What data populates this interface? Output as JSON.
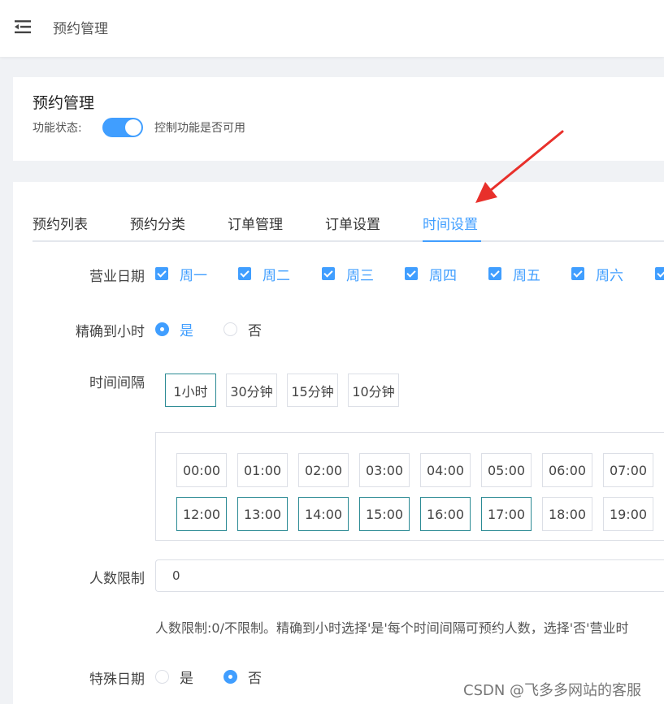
{
  "header": {
    "title": "预约管理",
    "menu_icon": "menu-fold-icon"
  },
  "module": {
    "title": "预约管理",
    "status_label": "功能状态:",
    "status_on": true,
    "status_desc": "控制功能是否可用"
  },
  "tabs": [
    {
      "label": "预约列表",
      "active": false
    },
    {
      "label": "预约分类",
      "active": false
    },
    {
      "label": "订单管理",
      "active": false
    },
    {
      "label": "订单设置",
      "active": false
    },
    {
      "label": "时间设置",
      "active": true
    }
  ],
  "form": {
    "business_days": {
      "label": "营业日期",
      "options": [
        {
          "label": "周一",
          "checked": true
        },
        {
          "label": "周二",
          "checked": true
        },
        {
          "label": "周三",
          "checked": true
        },
        {
          "label": "周四",
          "checked": true
        },
        {
          "label": "周五",
          "checked": true
        },
        {
          "label": "周六",
          "checked": true
        },
        {
          "label": "",
          "checked": true
        }
      ]
    },
    "hourly": {
      "label": "精确到小时",
      "options": [
        {
          "label": "是",
          "selected": true
        },
        {
          "label": "否",
          "selected": false
        }
      ]
    },
    "interval": {
      "label": "时间间隔",
      "options": [
        {
          "label": "1小时",
          "active": true
        },
        {
          "label": "30分钟",
          "active": false
        },
        {
          "label": "15分钟",
          "active": false
        },
        {
          "label": "10分钟",
          "active": false
        }
      ]
    },
    "slots": {
      "row1": [
        {
          "label": "00:00",
          "selected": false
        },
        {
          "label": "01:00",
          "selected": false
        },
        {
          "label": "02:00",
          "selected": false
        },
        {
          "label": "03:00",
          "selected": false
        },
        {
          "label": "04:00",
          "selected": false
        },
        {
          "label": "05:00",
          "selected": false
        },
        {
          "label": "06:00",
          "selected": false
        },
        {
          "label": "07:00",
          "selected": false
        }
      ],
      "row2": [
        {
          "label": "12:00",
          "selected": true
        },
        {
          "label": "13:00",
          "selected": true
        },
        {
          "label": "14:00",
          "selected": true
        },
        {
          "label": "15:00",
          "selected": true
        },
        {
          "label": "16:00",
          "selected": true
        },
        {
          "label": "17:00",
          "selected": true
        },
        {
          "label": "18:00",
          "selected": false
        },
        {
          "label": "19:00",
          "selected": false
        }
      ]
    },
    "people_limit": {
      "label": "人数限制",
      "value": "0",
      "help": "人数限制:0/不限制。精确到小时选择'是'每个时间间隔可预约人数，选择'否'营业时"
    },
    "special_date": {
      "label": "特殊日期",
      "options": [
        {
          "label": "是",
          "selected": false
        },
        {
          "label": "否",
          "selected": true
        }
      ]
    }
  },
  "watermark": "CSDN @飞多多网站的客服",
  "colors": {
    "primary": "#409eff",
    "slot_selected_border": "#2b8a94",
    "annotation_arrow": "#e8302b"
  }
}
